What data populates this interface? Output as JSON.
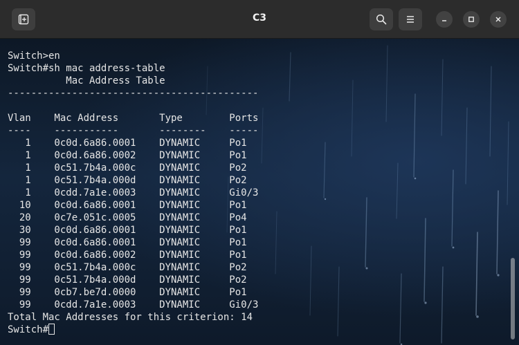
{
  "window": {
    "title": "C3"
  },
  "icons": {
    "new_tab": "new-tab-icon",
    "search": "search-icon",
    "menu": "hamburger-menu-icon",
    "minimize": "minimize-icon",
    "maximize": "maximize-icon",
    "close": "close-icon"
  },
  "colors": {
    "titlebar": "#2c2c2c",
    "terminal_text": "#e6e6e6",
    "terminal_bg": "#0f1d2e"
  },
  "terminal": {
    "lines": [
      "Switch>en",
      "Switch#sh mac address-table",
      "          Mac Address Table",
      "-------------------------------------------",
      "",
      "Vlan    Mac Address       Type        Ports",
      "----    -----------       --------    -----",
      "   1    0c0d.6a86.0001    DYNAMIC     Po1",
      "   1    0c0d.6a86.0002    DYNAMIC     Po1",
      "   1    0c51.7b4a.000c    DYNAMIC     Po2",
      "   1    0c51.7b4a.000d    DYNAMIC     Po2",
      "   1    0cdd.7a1e.0003    DYNAMIC     Gi0/3",
      "  10    0c0d.6a86.0001    DYNAMIC     Po1",
      "  20    0c7e.051c.0005    DYNAMIC     Po4",
      "  30    0c0d.6a86.0001    DYNAMIC     Po1",
      "  99    0c0d.6a86.0001    DYNAMIC     Po1",
      "  99    0c0d.6a86.0002    DYNAMIC     Po1",
      "  99    0c51.7b4a.000c    DYNAMIC     Po2",
      "  99    0c51.7b4a.000d    DYNAMIC     Po2",
      "  99    0cb7.be7d.0000    DYNAMIC     Po1",
      "  99    0cdd.7a1e.0003    DYNAMIC     Gi0/3",
      "Total Mac Addresses for this criterion: 14"
    ],
    "prompt": "Switch#"
  }
}
